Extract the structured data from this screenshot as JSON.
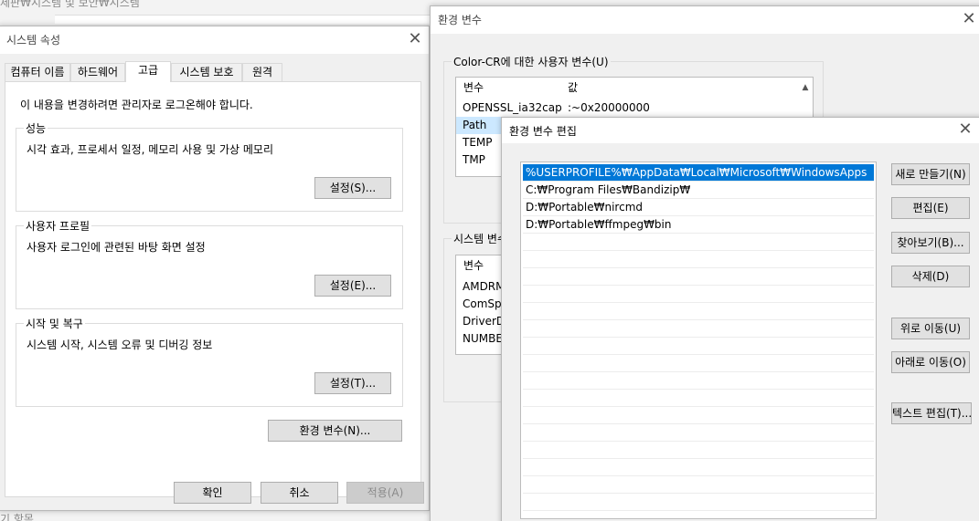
{
  "background": {
    "path_fragment": "제판₩시스템 및 보안₩시스템",
    "bottom_fragment": "기 항목"
  },
  "system_properties": {
    "title": "시스템 속성",
    "tabs": [
      {
        "label": "컴퓨터 이름"
      },
      {
        "label": "하드웨어"
      },
      {
        "label": "고급",
        "active": true
      },
      {
        "label": "시스템 보호"
      },
      {
        "label": "원격"
      }
    ],
    "admin_notice": "이 내용을 변경하려면 관리자로 로그온해야 합니다.",
    "performance": {
      "label": "성능",
      "description": "시각 효과, 프로세서 일정, 메모리 사용 및 가상 메모리",
      "button": "설정(S)..."
    },
    "user_profile": {
      "label": "사용자 프로필",
      "description": "사용자 로그인에 관련된 바탕 화면 설정",
      "button": "설정(E)..."
    },
    "startup_recovery": {
      "label": "시작 및 복구",
      "description": "시스템 시작, 시스템 오류 및 디버깅 정보",
      "button": "설정(T)..."
    },
    "env_button": "환경 변수(N)...",
    "ok": "확인",
    "cancel": "취소",
    "apply": "적용(A)"
  },
  "env_vars": {
    "title": "환경 변수",
    "user_group_label": "Color-CR에 대한 사용자 변수(U)",
    "user_columns": [
      "변수",
      "값"
    ],
    "user_rows": [
      {
        "name": "OPENSSL_ia32cap",
        "value": ":~0x20000000"
      },
      {
        "name": "Path",
        "value": ""
      },
      {
        "name": "TEMP",
        "value": ""
      },
      {
        "name": "TMP",
        "value": ""
      }
    ],
    "system_group_label": "시스템 변수",
    "system_columns": [
      "변수"
    ],
    "system_rows": [
      {
        "name": "AMDRM"
      },
      {
        "name": "ComSpe"
      },
      {
        "name": "DriverDa"
      },
      {
        "name": "NUMBER"
      }
    ]
  },
  "edit_env": {
    "title": "환경 변수 편집",
    "entries": [
      "%USERPROFILE%₩AppData₩Local₩Microsoft₩WindowsApps",
      "C:₩Program Files₩Bandizip₩",
      "D:₩Portable₩nircmd",
      "D:₩Portable₩ffmpeg₩bin"
    ],
    "selected_index": 0,
    "buttons": {
      "new": "새로 만들기(N)",
      "edit": "편집(E)",
      "browse": "찾아보기(B)...",
      "delete": "삭제(D)",
      "move_up": "위로 이동(U)",
      "move_down": "아래로 이동(O)",
      "edit_text": "텍스트 편집(T)..."
    }
  },
  "icons": {
    "close": "close-icon",
    "scroll_up": "scroll-up-arrow-icon"
  },
  "colors": {
    "selection": "#0078d7",
    "selection_light": "#cce8ff"
  }
}
